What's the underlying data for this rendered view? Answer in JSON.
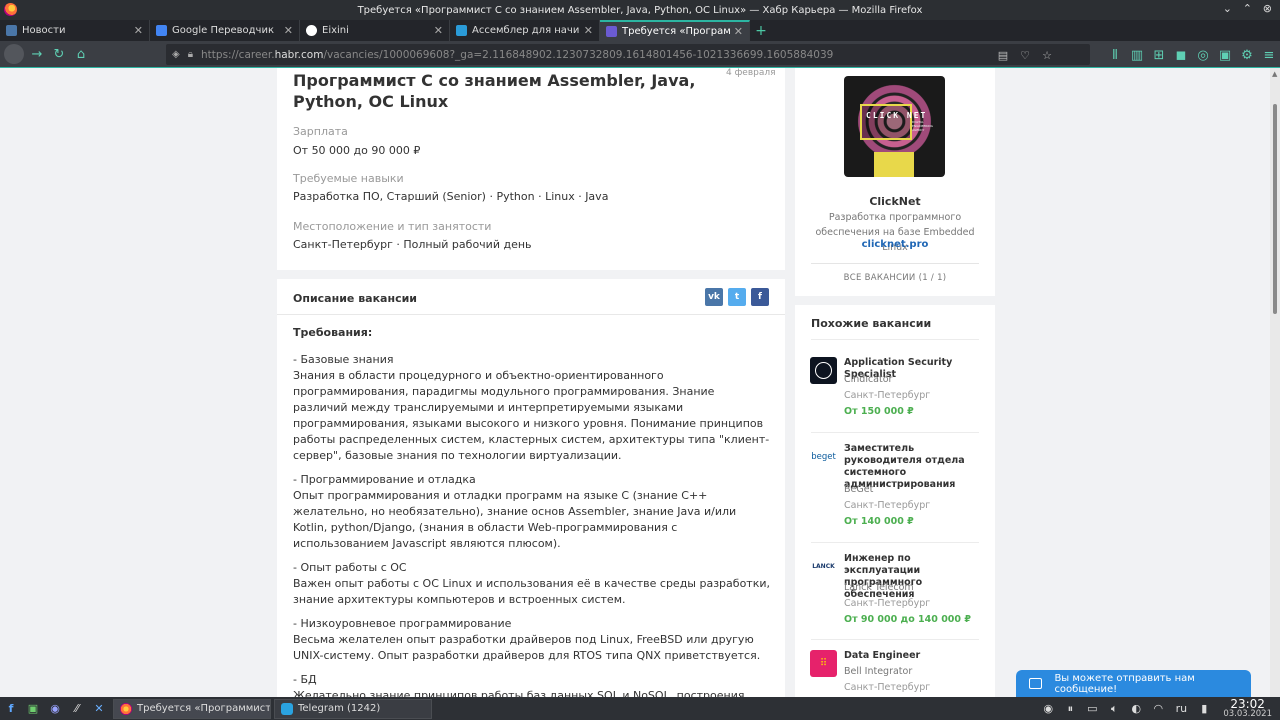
{
  "window": {
    "title": "Требуется «Программист С со знанием Assembler, Java, Python, ОС Linux» — Хабр Карьера — Mozilla Firefox"
  },
  "tabs": [
    {
      "label": "Новости",
      "color": "#4a76a8"
    },
    {
      "label": "Google Переводчик",
      "color": "#4285f4"
    },
    {
      "label": "Eixini",
      "color": "#ffffff"
    },
    {
      "label": "Ассемблер для начина",
      "color": "#2a9bd8"
    },
    {
      "label": "Требуется «Программ",
      "color": "#6b5bd2"
    }
  ],
  "address": {
    "prefix": "https://career.",
    "host": "habr.com",
    "path": "/vacancies/1000069608?_ga=2.116848902.1230732809.1614801456-1021336699.1605884039"
  },
  "vacancy": {
    "title": "Программист С со знанием Assembler, Java, Python, ОС Linux",
    "date": "4 февраля",
    "salary_label": "Зарплата",
    "salary": "От 50 000 до 90 000 ₽",
    "skills_label": "Требуемые навыки",
    "skills": "Разработка ПО, Старший (Senior) · Python · Linux · Java",
    "location_label": "Местоположение и тип занятости",
    "location": "Санкт-Петербург · Полный рабочий день"
  },
  "description": {
    "heading": "Описание вакансии",
    "share": {
      "vk": "vk",
      "tw": "t",
      "fb": "f"
    },
    "requirements": "Требования:",
    "p1_title": "- Базовые знания",
    "p1_text": "Знания в области процедурного и объектно-ориентированного программирования, парадигмы модульного программирования. Знание различий между транслируемыми и интерпретируемыми языками",
    "p1_text2": "программирования, языками высокого и низкого уровня. Понимание принципов работы распределенных систем, кластерных систем, архитектуры типа \"клиент-сервер\", базовые знания по технологии виртуализации.",
    "p2_title": "- Программирование и отладка",
    "p2_text": "Опыт программирования и отладки программ на языке С (знание С++ желательно, но необязательно), знание основ Assembler, знание Java и/или Kotlin, python/Django, (знания в области Web-программирования с использованием Javascript являются плюсом).",
    "p3_title": "- Опыт работы с ОС",
    "p3_text": "Важен опыт работы с ОС Linux и использования её в качестве среды разработки, знание архитектуры компьютеров и встроенных систем.",
    "p4_title": "- Низкоуровневое программирование",
    "p4_text": "Весьма желателен опыт разработки драйверов под Linux, FreeBSD или другую UNIX-систему. Опыт разработки драйверов для RTOS типа QNX приветствуется.",
    "p5_title": "- БД",
    "p5_text": "Желательно знание принципов работы баз данных SQL и NoSQL, построения"
  },
  "company": {
    "logo_text": "CLICK NET",
    "logo_small": "DIGITAL ENGINEERING AGENCY",
    "name": "ClickNet",
    "desc": "Разработка программного обеспечения на базе Embedded Linux",
    "link": "clicknet.pro",
    "all_vacancies": "ВСЕ ВАКАНСИИ (1 / 1)"
  },
  "similar": {
    "heading": "Похожие вакансии",
    "items": [
      {
        "title": "Application Security Specialist",
        "company": "Cindicator",
        "city": "Санкт-Петербург",
        "salary": "От 150 000 ₽",
        "logo": ""
      },
      {
        "title": "Заместитель руководителя отдела системного администрирования",
        "company": "BeGet",
        "city": "Санкт-Петербург",
        "salary": "От 140 000 ₽",
        "logo": "beget"
      },
      {
        "title": "Инженер по эксплуатации программного обеспечения",
        "company": "Lanck Telecom",
        "city": "Санкт-Петербург",
        "salary": "От 90 000 до 140 000 ₽",
        "logo": "LANCK"
      },
      {
        "title": "Data Engineer",
        "company": "Bell Integrator",
        "city": "Санкт-Петербург",
        "salary": "",
        "logo": ""
      }
    ]
  },
  "chat": {
    "text": "Вы можете отправить нам сообщение!"
  },
  "taskbar": {
    "task1": "Требуется «Программист С...",
    "task2": "Telegram (1242)",
    "lang": "ru",
    "time": "23:02",
    "date": "03.03.2021"
  }
}
